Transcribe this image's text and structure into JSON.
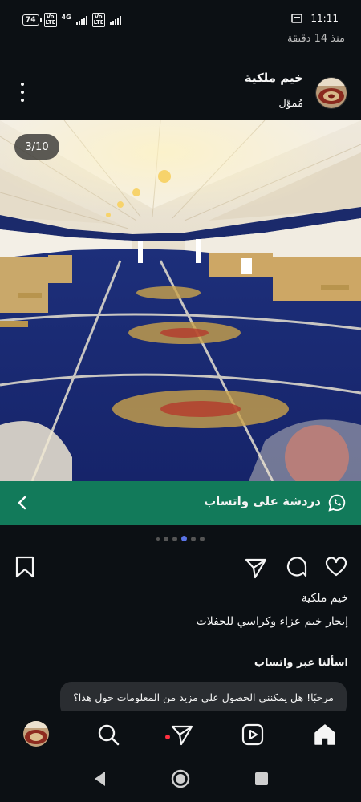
{
  "status_bar": {
    "battery": "74",
    "volte_1": "Vo LTE",
    "network": "4G",
    "volte_2": "Vo LTE",
    "time": "11:11"
  },
  "post": {
    "time_ago": "منذ 14 دقيقة",
    "profile_name": "خيم ملكية",
    "sponsored_label": "مُموَّل",
    "image_counter": "3/10",
    "image_description_icon": "photo",
    "cta_label": "دردشة على واتساب",
    "carousel": {
      "count": 6,
      "active_index": 3
    },
    "caption_name": "خيم ملكية",
    "caption_text": "إيجار خيم عزاء وكراسي للحفلات",
    "ask_title": "اسألنا عبر واتساب",
    "message_prompt": "مرحبًا! هل يمكنني الحصول على مزيد من المعلومات حول هذا؟"
  },
  "colors": {
    "background": "#0c1014",
    "cta_green": "#127a5a",
    "active_dot": "#5a73e6",
    "notification_dot": "#ff3040"
  },
  "icons": {
    "more": "more-vertical-icon",
    "like": "heart-icon",
    "comment": "comment-icon",
    "share": "send-icon",
    "save": "bookmark-icon",
    "whatsapp": "whatsapp-icon",
    "chevron": "chevron-left-icon",
    "home": "home-icon",
    "reels": "reels-icon",
    "send_nav": "send-icon",
    "search": "search-icon",
    "back": "back-triangle-icon",
    "system_home": "home-circle-icon",
    "recents": "recents-square-icon"
  }
}
